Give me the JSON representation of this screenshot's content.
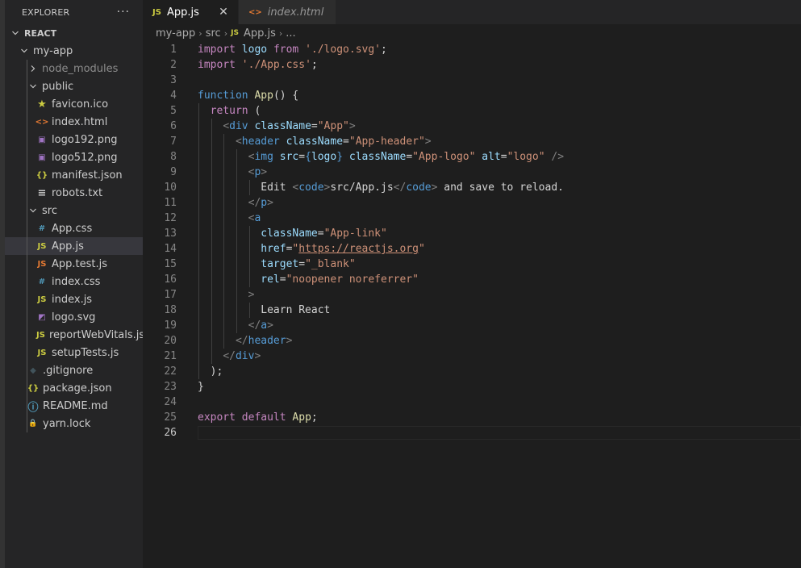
{
  "sidebar": {
    "title": "EXPLORER",
    "more": "···",
    "tree": [
      {
        "label": "REACT",
        "depth": 0,
        "kind": "folder-open",
        "root": true
      },
      {
        "label": "my-app",
        "depth": 1,
        "kind": "folder-open"
      },
      {
        "label": "node_modules",
        "depth": 2,
        "kind": "folder-closed",
        "dim": true
      },
      {
        "label": "public",
        "depth": 2,
        "kind": "folder-open"
      },
      {
        "label": "favicon.ico",
        "depth": 3,
        "icon": "star-icon"
      },
      {
        "label": "index.html",
        "depth": 3,
        "icon": "html-icon"
      },
      {
        "label": "logo192.png",
        "depth": 3,
        "icon": "image-icon"
      },
      {
        "label": "logo512.png",
        "depth": 3,
        "icon": "image-icon"
      },
      {
        "label": "manifest.json",
        "depth": 3,
        "icon": "json-icon"
      },
      {
        "label": "robots.txt",
        "depth": 3,
        "icon": "text-icon"
      },
      {
        "label": "src",
        "depth": 2,
        "kind": "folder-open"
      },
      {
        "label": "App.css",
        "depth": 3,
        "icon": "css-icon"
      },
      {
        "label": "App.js",
        "depth": 3,
        "icon": "js-icon",
        "selected": true
      },
      {
        "label": "App.test.js",
        "depth": 3,
        "icon": "js-test-icon"
      },
      {
        "label": "index.css",
        "depth": 3,
        "icon": "css-icon"
      },
      {
        "label": "index.js",
        "depth": 3,
        "icon": "js-icon"
      },
      {
        "label": "logo.svg",
        "depth": 3,
        "icon": "svg-icon"
      },
      {
        "label": "reportWebVitals.js",
        "depth": 3,
        "icon": "js-icon"
      },
      {
        "label": "setupTests.js",
        "depth": 3,
        "icon": "js-icon"
      },
      {
        "label": ".gitignore",
        "depth": 2,
        "icon": "git-icon"
      },
      {
        "label": "package.json",
        "depth": 2,
        "icon": "json-icon"
      },
      {
        "label": "README.md",
        "depth": 2,
        "icon": "info-icon"
      },
      {
        "label": "yarn.lock",
        "depth": 2,
        "icon": "lock-file-icon"
      }
    ]
  },
  "tabs": [
    {
      "label": "App.js",
      "icon": "JS",
      "active": true,
      "close": "✕"
    },
    {
      "label": "index.html",
      "icon": "<>",
      "active": false
    }
  ],
  "breadcrumb": [
    "my-app",
    "src",
    "App.js",
    "..."
  ],
  "breadcrumb_js": "JS",
  "icon_colors": {
    "js-icon": "#cbcb41",
    "js-test-icon": "#e37933",
    "css-icon": "#519aba",
    "html-icon": "#e37933",
    "json-icon": "#cbcb41",
    "image-icon": "#a074c4",
    "star-icon": "#cbcb41",
    "text-icon": "#cccccc",
    "svg-icon": "#a074c4",
    "git-icon": "#41535b",
    "info-icon": "#519aba",
    "lock-file-icon": "#8dc149"
  },
  "code": {
    "current_line": 26,
    "lines": [
      [
        [
          "kw2",
          "import"
        ],
        [
          "t",
          " "
        ],
        [
          "var",
          "logo"
        ],
        [
          "t",
          " "
        ],
        [
          "kw2",
          "from"
        ],
        [
          "t",
          " "
        ],
        [
          "str",
          "'./logo.svg'"
        ],
        [
          "t",
          ";"
        ]
      ],
      [
        [
          "kw2",
          "import"
        ],
        [
          "t",
          " "
        ],
        [
          "str",
          "'./App.css'"
        ],
        [
          "t",
          ";"
        ]
      ],
      [],
      [
        [
          "kw",
          "function"
        ],
        [
          "t",
          " "
        ],
        [
          "fn",
          "App"
        ],
        [
          "t",
          "() {"
        ]
      ],
      [
        [
          "t",
          "  "
        ],
        [
          "kw2",
          "return"
        ],
        [
          "t",
          " ("
        ]
      ],
      [
        [
          "t",
          "    "
        ],
        [
          "tagp",
          "<"
        ],
        [
          "tag",
          "div"
        ],
        [
          "t",
          " "
        ],
        [
          "attr",
          "className"
        ],
        [
          "t",
          "="
        ],
        [
          "str",
          "\"App\""
        ],
        [
          "tagp",
          ">"
        ]
      ],
      [
        [
          "t",
          "      "
        ],
        [
          "tagp",
          "<"
        ],
        [
          "tag",
          "header"
        ],
        [
          "t",
          " "
        ],
        [
          "attr",
          "className"
        ],
        [
          "t",
          "="
        ],
        [
          "str",
          "\"App-header\""
        ],
        [
          "tagp",
          ">"
        ]
      ],
      [
        [
          "t",
          "        "
        ],
        [
          "tagp",
          "<"
        ],
        [
          "tag",
          "img"
        ],
        [
          "t",
          " "
        ],
        [
          "attr",
          "src"
        ],
        [
          "t",
          "="
        ],
        [
          "kw",
          "{"
        ],
        [
          "var",
          "logo"
        ],
        [
          "kw",
          "}"
        ],
        [
          "t",
          " "
        ],
        [
          "attr",
          "className"
        ],
        [
          "t",
          "="
        ],
        [
          "str",
          "\"App-logo\""
        ],
        [
          "t",
          " "
        ],
        [
          "attr",
          "alt"
        ],
        [
          "t",
          "="
        ],
        [
          "str",
          "\"logo\""
        ],
        [
          "t",
          " "
        ],
        [
          "tagp",
          "/>"
        ]
      ],
      [
        [
          "t",
          "        "
        ],
        [
          "tagp",
          "<"
        ],
        [
          "tag",
          "p"
        ],
        [
          "tagp",
          ">"
        ]
      ],
      [
        [
          "t",
          "          Edit "
        ],
        [
          "tagp",
          "<"
        ],
        [
          "tag",
          "code"
        ],
        [
          "tagp",
          ">"
        ],
        [
          "t",
          "src/App.js"
        ],
        [
          "tagp",
          "</"
        ],
        [
          "tag",
          "code"
        ],
        [
          "tagp",
          ">"
        ],
        [
          "t",
          " and save to reload."
        ]
      ],
      [
        [
          "t",
          "        "
        ],
        [
          "tagp",
          "</"
        ],
        [
          "tag",
          "p"
        ],
        [
          "tagp",
          ">"
        ]
      ],
      [
        [
          "t",
          "        "
        ],
        [
          "tagp",
          "<"
        ],
        [
          "tag",
          "a"
        ]
      ],
      [
        [
          "t",
          "          "
        ],
        [
          "attr",
          "className"
        ],
        [
          "t",
          "="
        ],
        [
          "str",
          "\"App-link\""
        ]
      ],
      [
        [
          "t",
          "          "
        ],
        [
          "attr",
          "href"
        ],
        [
          "t",
          "="
        ],
        [
          "str",
          "\""
        ],
        [
          "url",
          "https://reactjs.org"
        ],
        [
          "str",
          "\""
        ]
      ],
      [
        [
          "t",
          "          "
        ],
        [
          "attr",
          "target"
        ],
        [
          "t",
          "="
        ],
        [
          "str",
          "\"_blank\""
        ]
      ],
      [
        [
          "t",
          "          "
        ],
        [
          "attr",
          "rel"
        ],
        [
          "t",
          "="
        ],
        [
          "str",
          "\"noopener noreferrer\""
        ]
      ],
      [
        [
          "t",
          "        "
        ],
        [
          "tagp",
          ">"
        ]
      ],
      [
        [
          "t",
          "          Learn React"
        ]
      ],
      [
        [
          "t",
          "        "
        ],
        [
          "tagp",
          "</"
        ],
        [
          "tag",
          "a"
        ],
        [
          "tagp",
          ">"
        ]
      ],
      [
        [
          "t",
          "      "
        ],
        [
          "tagp",
          "</"
        ],
        [
          "tag",
          "header"
        ],
        [
          "tagp",
          ">"
        ]
      ],
      [
        [
          "t",
          "    "
        ],
        [
          "tagp",
          "</"
        ],
        [
          "tag",
          "div"
        ],
        [
          "tagp",
          ">"
        ]
      ],
      [
        [
          "t",
          "  );"
        ]
      ],
      [
        [
          "t",
          "}"
        ]
      ],
      [],
      [
        [
          "kw2",
          "export"
        ],
        [
          "t",
          " "
        ],
        [
          "kw2",
          "default"
        ],
        [
          "t",
          " "
        ],
        [
          "fn",
          "App"
        ],
        [
          "t",
          ";"
        ]
      ],
      []
    ]
  }
}
